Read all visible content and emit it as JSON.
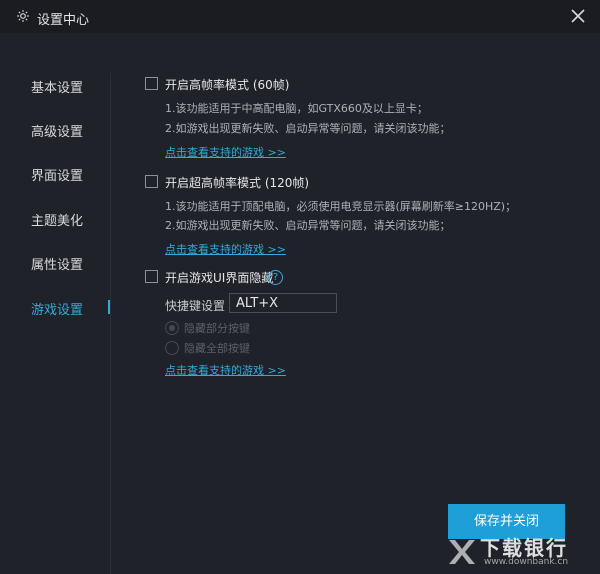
{
  "window": {
    "title": "设置中心",
    "icons": {
      "settings": "gear-icon",
      "close": "close-icon"
    }
  },
  "sidebar": {
    "items": [
      {
        "label": "基本设置"
      },
      {
        "label": "高级设置"
      },
      {
        "label": "界面设置"
      },
      {
        "label": "主题美化"
      },
      {
        "label": "属性设置"
      },
      {
        "label": "游戏设置",
        "active": true
      }
    ]
  },
  "options": {
    "high_fps": {
      "label": "开启高帧率模式 (60帧)",
      "checked": false,
      "desc1": "1.该功能适用于中高配电脑，如GTX660及以上显卡；",
      "desc2": "2.如游戏出现更新失败、启动异常等问题，请关闭该功能；",
      "link": "点击查看支持的游戏 >>"
    },
    "ultra_fps": {
      "label": "开启超高帧率模式 (120帧)",
      "checked": false,
      "desc1": "1.该功能适用于顶配电脑，必须使用电竞显示器(屏幕刷新率≥120HZ)；",
      "desc2": "2.如游戏出现更新失败、启动异常等问题，请关闭该功能；",
      "link": "点击查看支持的游戏 >>"
    },
    "hide_ui": {
      "label": "开启游戏UI界面隐藏",
      "checked": false,
      "help": "?",
      "hotkey_label": "快捷键设置",
      "hotkey_value": "ALT+X",
      "radio1": "隐藏部分按键",
      "radio2": "隐藏全部按键",
      "selected": "隐藏部分按键",
      "link": "点击查看支持的游戏 >>"
    }
  },
  "footer": {
    "save_label": "保存并关闭"
  },
  "watermark": {
    "text1": "下载银行",
    "text2": "www.downbank.cn"
  },
  "colors": {
    "accent": "#37a9d9",
    "button": "#1e9fd8",
    "background": "#1f2228",
    "titlebar": "#1a1c21"
  }
}
